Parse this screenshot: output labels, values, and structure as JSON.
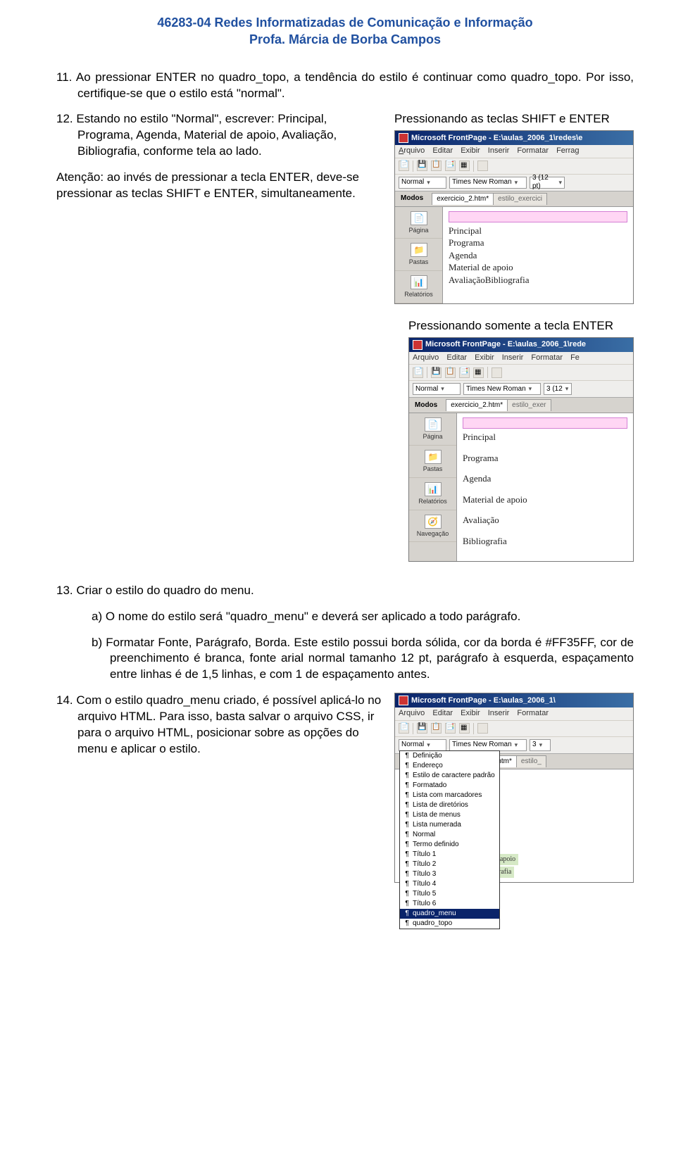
{
  "header": {
    "line1": "46283-04 Redes Informatizadas de Comunicação e Informação",
    "line2": "Profa. Márcia de Borba Campos"
  },
  "p11": "11. Ao pressionar ENTER no quadro_topo, a tendência do estilo é continuar como quadro_topo. Por isso, certifique-se que o estilo está \"normal\".",
  "p12": "12. Estando no estilo \"Normal\", escrever: Principal, Programa, Agenda, Material de apoio, Avaliação, Bibliografia, conforme tela ao lado.",
  "p12_note": "Atenção: ao invés de pressionar a tecla ENTER, deve-se pressionar as teclas SHIFT e ENTER, simultaneamente.",
  "cap_a": "Pressionando as teclas SHIFT e ENTER",
  "cap_b": "Pressionando somente a tecla ENTER",
  "fp": {
    "title_a": "Microsoft FrontPage - E:\\aulas_2006_1\\redes\\e",
    "title_b": "Microsoft FrontPage - E:\\aulas_2006_1\\rede",
    "title_c": "Microsoft FrontPage - E:\\aulas_2006_1\\",
    "menu_arquivo": "Arquivo",
    "menu_editar": "Editar",
    "menu_exibir": "Exibir",
    "menu_inserir": "Inserir",
    "menu_formatar": "Formatar",
    "menu_ferrag": "Ferrag",
    "menu_fe": "Fe",
    "style_normal": "Normal",
    "font": "Times New Roman",
    "size12pt": "3 (12 pt)",
    "size12": "3 (12",
    "size3": "3",
    "modos": "Modos",
    "tab_active": "exercicio_2.htm*",
    "tab_inactive_a": "estilo_exercici",
    "tab_inactive_b": "estilo_exer",
    "tab_inactive_c": "2.htm*",
    "tab_inactive_d": "estilo_",
    "side_pagina": "Página",
    "side_pastas": "Pastas",
    "side_rel": "Relatórios",
    "side_nav": "Navegação",
    "content_items": [
      "Principal",
      "Programa",
      "Agenda",
      "Material de apoio",
      "AvaliaçãoBibliografia"
    ],
    "content_items_b": [
      "Principal",
      "Programa",
      "Agenda",
      "Material de apoio",
      "Avaliação",
      "Bibliografia"
    ],
    "style_list": [
      {
        "mark": "¶",
        "label": "Definição"
      },
      {
        "mark": "¶",
        "label": "Endereço"
      },
      {
        "mark": "¶",
        "label": "Estilo de caractere padrão"
      },
      {
        "mark": "¶",
        "label": "Formatado"
      },
      {
        "mark": "¶",
        "label": "Lista com marcadores"
      },
      {
        "mark": "¶",
        "label": "Lista de diretórios"
      },
      {
        "mark": "¶",
        "label": "Lista de menus"
      },
      {
        "mark": "¶",
        "label": "Lista numerada"
      },
      {
        "mark": "¶",
        "label": "Normal"
      },
      {
        "mark": "¶",
        "label": "Termo definido"
      },
      {
        "mark": "¶",
        "label": "Título 1"
      },
      {
        "mark": "¶",
        "label": "Título 2"
      },
      {
        "mark": "¶",
        "label": "Título 3"
      },
      {
        "mark": "¶",
        "label": "Título 4"
      },
      {
        "mark": "¶",
        "label": "Título 5"
      },
      {
        "mark": "¶",
        "label": "Título 6"
      },
      {
        "mark": "¶",
        "label": "quadro_menu"
      },
      {
        "mark": "¶",
        "label": "quadro_topo"
      }
    ],
    "style_sel_index": 16,
    "body_c_text1": "e apoio",
    "body_c_text2": "grafia"
  },
  "p13": "13. Criar o estilo do quadro do menu.",
  "p13a": "a) O nome do estilo será \"quadro_menu\" e deverá ser aplicado a todo parágrafo.",
  "p13b": "b) Formatar Fonte, Parágrafo, Borda. Este estilo possui borda sólida, cor da borda é #FF35FF, cor de preenchimento é branca, fonte arial normal tamanho 12 pt, parágrafo à esquerda, espaçamento entre linhas é de 1,5 linhas, e com 1 de espaçamento antes.",
  "p14": "14. Com o estilo quadro_menu criado, é possível aplicá-lo no arquivo HTML. Para isso, basta salvar o arquivo CSS, ir para o arquivo HTML, posicionar sobre as opções do menu e aplicar o estilo."
}
